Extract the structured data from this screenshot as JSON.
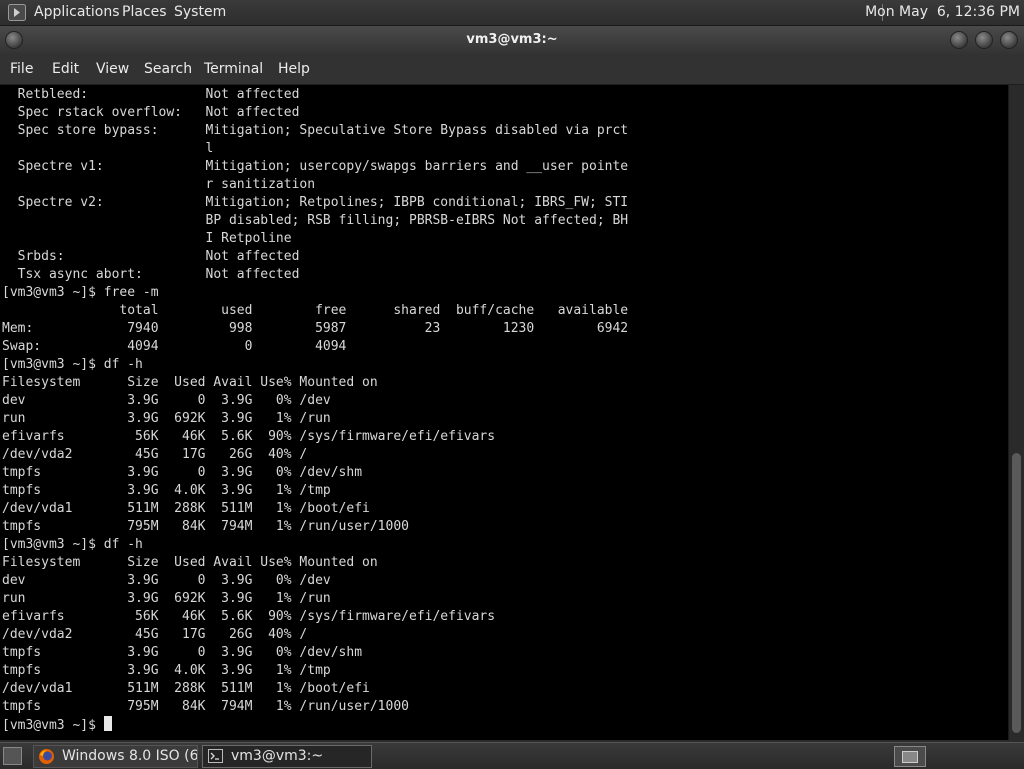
{
  "top_panel": {
    "menus": [
      "Applications",
      "Places",
      "System"
    ],
    "clock": "Mon May  6, 12:36 PM"
  },
  "window": {
    "title": "vm3@vm3:~"
  },
  "menubar": {
    "items": [
      "File",
      "Edit",
      "View",
      "Search",
      "Terminal",
      "Help"
    ]
  },
  "terminal": {
    "lines": [
      "  Retbleed:               Not affected",
      "  Spec rstack overflow:   Not affected",
      "  Spec store bypass:      Mitigation; Speculative Store Bypass disabled via prct",
      "                          l",
      "  Spectre v1:             Mitigation; usercopy/swapgs barriers and __user pointe",
      "                          r sanitization",
      "  Spectre v2:             Mitigation; Retpolines; IBPB conditional; IBRS_FW; STI",
      "                          BP disabled; RSB filling; PBRSB-eIBRS Not affected; BH",
      "                          I Retpoline",
      "  Srbds:                  Not affected",
      "  Tsx async abort:        Not affected",
      "[vm3@vm3 ~]$ free -m",
      "               total        used        free      shared  buff/cache   available",
      "Mem:            7940         998        5987          23        1230        6942",
      "Swap:           4094           0        4094",
      "[vm3@vm3 ~]$ df -h",
      "Filesystem      Size  Used Avail Use% Mounted on",
      "dev             3.9G     0  3.9G   0% /dev",
      "run             3.9G  692K  3.9G   1% /run",
      "efivarfs         56K   46K  5.6K  90% /sys/firmware/efi/efivars",
      "/dev/vda2        45G   17G   26G  40% /",
      "tmpfs           3.9G     0  3.9G   0% /dev/shm",
      "tmpfs           3.9G  4.0K  3.9G   1% /tmp",
      "/dev/vda1       511M  288K  511M   1% /boot/efi",
      "tmpfs           795M   84K  794M   1% /run/user/1000",
      "[vm3@vm3 ~]$ df -h",
      "Filesystem      Size  Used Avail Use% Mounted on",
      "dev             3.9G     0  3.9G   0% /dev",
      "run             3.9G  692K  3.9G   1% /run",
      "efivarfs         56K   46K  5.6K  90% /sys/firmware/efi/efivars",
      "/dev/vda2        45G   17G   26G  40% /",
      "tmpfs           3.9G     0  3.9G   0% /dev/shm",
      "tmpfs           3.9G  4.0K  3.9G   1% /tmp",
      "/dev/vda1       511M  288K  511M   1% /boot/efi",
      "tmpfs           795M   84K  794M   1% /run/user/1000"
    ],
    "prompt": "[vm3@vm3 ~]$ "
  },
  "taskbar": {
    "tasks": [
      {
        "label": "Windows 8.0 ISO (6...",
        "icon": "firefox-icon"
      },
      {
        "label": "vm3@vm3:~",
        "icon": "terminal-icon"
      }
    ]
  },
  "colors": {
    "terminal_bg": "#000000",
    "terminal_fg": "#d8d8d8",
    "panel_bg": "#333333"
  }
}
